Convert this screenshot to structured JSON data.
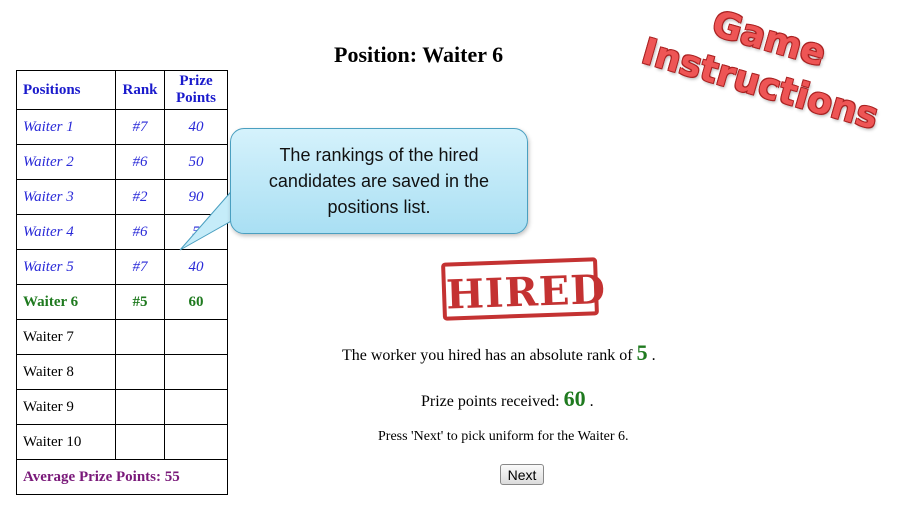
{
  "title": "Position: Waiter 6",
  "game_instructions": [
    "Game",
    "Instructions"
  ],
  "table": {
    "headers": [
      "Positions",
      "Rank",
      "Prize Points"
    ],
    "rows": [
      {
        "position": "Waiter 1",
        "rank": "#7",
        "points": "40",
        "state": "done"
      },
      {
        "position": "Waiter 2",
        "rank": "#6",
        "points": "50",
        "state": "done"
      },
      {
        "position": "Waiter 3",
        "rank": "#2",
        "points": "90",
        "state": "done"
      },
      {
        "position": "Waiter 4",
        "rank": "#6",
        "points": "5",
        "state": "done"
      },
      {
        "position": "Waiter 5",
        "rank": "#7",
        "points": "40",
        "state": "done"
      },
      {
        "position": "Waiter 6",
        "rank": "#5",
        "points": "60",
        "state": "current"
      },
      {
        "position": "Waiter 7",
        "rank": "",
        "points": "",
        "state": "empty"
      },
      {
        "position": "Waiter 8",
        "rank": "",
        "points": "",
        "state": "empty"
      },
      {
        "position": "Waiter 9",
        "rank": "",
        "points": "",
        "state": "empty"
      },
      {
        "position": "Waiter 10",
        "rank": "",
        "points": "",
        "state": "empty"
      }
    ],
    "average": "Average Prize Points: 55"
  },
  "callout": "The rankings of the hired candidates are saved in the positions list.",
  "stamp": "HIRED",
  "rank_msg": {
    "prefix": "The worker you hired has an absolute rank of",
    "value": "5",
    "suffix": "."
  },
  "points_msg": {
    "prefix": "Prize points received:",
    "value": "60",
    "suffix": "."
  },
  "instruction": "Press 'Next' to pick uniform for the Waiter 6.",
  "next_label": "Next",
  "colors": {
    "done": "#2a2ad8",
    "current": "#1f7a1f",
    "average": "#7a1a7a",
    "stamp": "#c43232"
  }
}
